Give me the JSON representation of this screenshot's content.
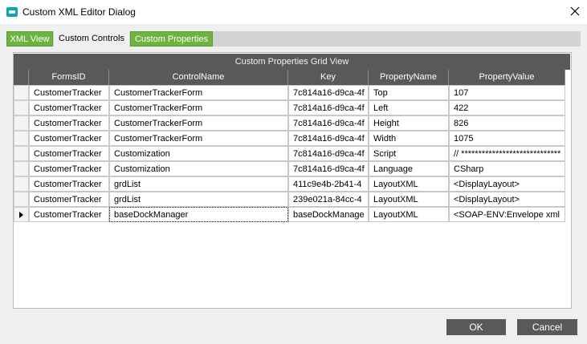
{
  "window": {
    "title": "Custom XML Editor Dialog",
    "accent_color": "#0ea5b7"
  },
  "tabs": [
    {
      "label": "XML View",
      "active": false,
      "color": "#6cb33f"
    },
    {
      "label": "Custom Controls",
      "active": false
    },
    {
      "label": "Custom Properties",
      "active": true,
      "color": "#6cb33f"
    }
  ],
  "grid": {
    "title": "Custom Properties Grid View",
    "columns": [
      "FormsID",
      "ControlName",
      "Key",
      "PropertyName",
      "PropertyValue"
    ],
    "rows": [
      {
        "forms_id": "CustomerTracker",
        "control_name": "CustomerTrackerForm",
        "key": "7c814a16-d9ca-4f",
        "property_name": "Top",
        "property_value": "107"
      },
      {
        "forms_id": "CustomerTracker",
        "control_name": "CustomerTrackerForm",
        "key": "7c814a16-d9ca-4f",
        "property_name": "Left",
        "property_value": "422"
      },
      {
        "forms_id": "CustomerTracker",
        "control_name": "CustomerTrackerForm",
        "key": "7c814a16-d9ca-4f",
        "property_name": "Height",
        "property_value": "826"
      },
      {
        "forms_id": "CustomerTracker",
        "control_name": "CustomerTrackerForm",
        "key": "7c814a16-d9ca-4f",
        "property_name": "Width",
        "property_value": "1075"
      },
      {
        "forms_id": "CustomerTracker",
        "control_name": "Customization",
        "key": "7c814a16-d9ca-4f",
        "property_name": "Script",
        "property_value": "// *****************************"
      },
      {
        "forms_id": "CustomerTracker",
        "control_name": "Customization",
        "key": "7c814a16-d9ca-4f",
        "property_name": "Language",
        "property_value": "CSharp"
      },
      {
        "forms_id": "CustomerTracker",
        "control_name": "grdList",
        "key": "411c9e4b-2b41-4",
        "property_name": "LayoutXML",
        "property_value": "<DisplayLayout>"
      },
      {
        "forms_id": "CustomerTracker",
        "control_name": "grdList",
        "key": "239e021a-84cc-4",
        "property_name": "LayoutXML",
        "property_value": "<DisplayLayout>"
      },
      {
        "forms_id": "CustomerTracker",
        "control_name": "baseDockManager",
        "key": "baseDockManage",
        "property_name": "LayoutXML",
        "property_value": "<SOAP-ENV:Envelope xml"
      }
    ]
  },
  "buttons": {
    "ok": "OK",
    "cancel": "Cancel"
  }
}
